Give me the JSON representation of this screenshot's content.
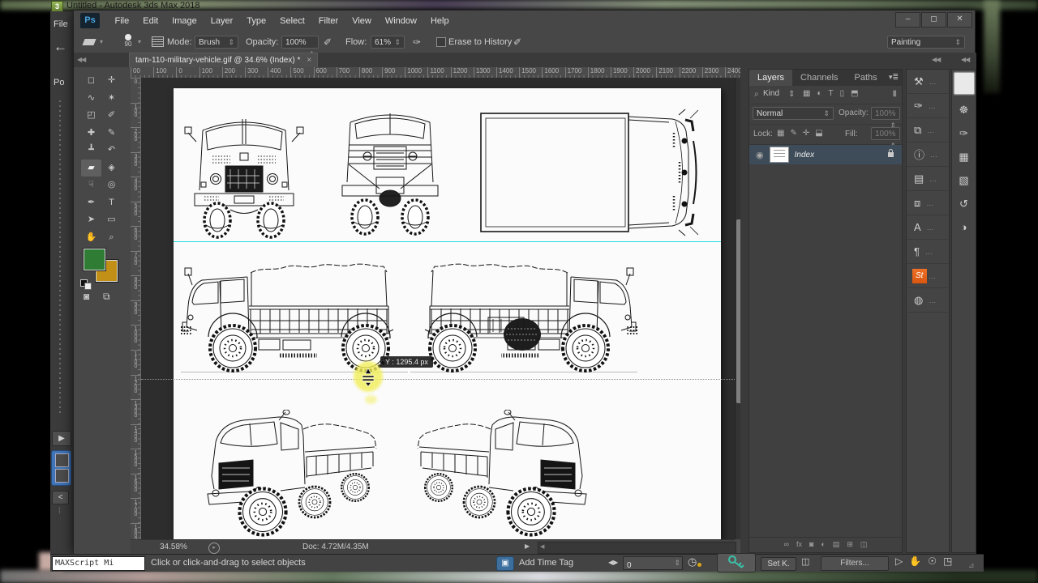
{
  "max_window": {
    "logo": "3",
    "title": "Untitled - Autodesk 3ds Max 2018",
    "file_menu": "File",
    "po_label": "Po",
    "play_glyph": "▶",
    "collapse_glyph": "<",
    "maxscript_label": "MAXScript Mi",
    "status_hint": "Click or click-and-drag to select objects",
    "add_time_tag": "Add Time Tag",
    "spinner_glyph": "◀▶",
    "frame_value": "0",
    "clock_glyph": "◷",
    "set_key_label": "Set K.",
    "key_filter_glyph": "◫",
    "filters_label": "Filters...",
    "nav_icons": [
      {
        "name": "zoom-mode-icon",
        "glyph": "▷"
      },
      {
        "name": "pan-hand-icon",
        "glyph": "✋"
      },
      {
        "name": "orbit-icon",
        "glyph": "☉"
      },
      {
        "name": "maximize-viewport-icon",
        "glyph": "◳"
      }
    ]
  },
  "photoshop": {
    "logo": "Ps",
    "menus": [
      "File",
      "Edit",
      "Image",
      "Layer",
      "Type",
      "Select",
      "Filter",
      "View",
      "Window",
      "Help"
    ],
    "window_buttons": [
      {
        "name": "minimize-button",
        "glyph": "–"
      },
      {
        "name": "maximize-button",
        "glyph": "◻"
      },
      {
        "name": "close-button",
        "glyph": "✕"
      }
    ],
    "collapse_glyph": "◀◀",
    "options_bar": {
      "tool_size": "90",
      "mode_label": "Mode:",
      "mode_value": "Brush",
      "opacity_label": "Opacity:",
      "opacity_value": "100%",
      "flow_label": "Flow:",
      "flow_value": "61%",
      "erase_history_label": "Erase to History",
      "workspace_value": "Painting"
    },
    "document_tab": {
      "title": "tam-110-military-vehicle.gif @ 34.6% (Index) *",
      "close_glyph": "×"
    },
    "ruler_h": [
      "00",
      "100",
      "0",
      "100",
      "200",
      "300",
      "400",
      "500",
      "600",
      "700",
      "800",
      "900",
      "1000",
      "1100",
      "1200",
      "1300",
      "1400",
      "1500",
      "1600",
      "1700",
      "1800",
      "1900",
      "2000",
      "2100",
      "2200",
      "2300",
      "2400"
    ],
    "ruler_v": [
      "0",
      "100",
      "200",
      "300",
      "400",
      "500",
      "600",
      "700",
      "800",
      "900",
      "1000",
      "1100",
      "1200",
      "1300",
      "1400",
      "1500",
      "1600",
      "1700",
      "1800"
    ],
    "tools": [
      {
        "name": "rectangular-marquee-tool",
        "glyph": "◻"
      },
      {
        "name": "move-tool",
        "glyph": "✛"
      },
      {
        "name": "lasso-tool",
        "glyph": "∿"
      },
      {
        "name": "magic-wand-tool",
        "glyph": "✶"
      },
      {
        "name": "crop-tool",
        "glyph": "◰"
      },
      {
        "name": "eyedropper-tool",
        "glyph": "✐"
      },
      {
        "name": "healing-brush-tool",
        "glyph": "✚"
      },
      {
        "name": "brush-tool",
        "glyph": "✎"
      },
      {
        "name": "clone-stamp-tool",
        "glyph": "┻"
      },
      {
        "name": "history-brush-tool",
        "glyph": "↶"
      },
      {
        "name": "eraser-tool",
        "glyph": "▰"
      },
      {
        "name": "paint-bucket-tool",
        "glyph": "◈"
      },
      {
        "name": "smudge-tool",
        "glyph": "☟"
      },
      {
        "name": "dodge-tool",
        "glyph": "◎"
      },
      {
        "name": "pen-tool",
        "glyph": "✒"
      },
      {
        "name": "type-tool",
        "glyph": "T"
      },
      {
        "name": "path-selection-tool",
        "glyph": "➤"
      },
      {
        "name": "rectangle-tool",
        "glyph": "▭"
      },
      {
        "name": "hand-tool",
        "glyph": "✋"
      },
      {
        "name": "zoom-tool",
        "glyph": "⌕"
      }
    ],
    "guide_tooltip": "Y :  1295.4 px",
    "status_bar": {
      "zoom_value": "34.58%",
      "doc_sizes": "Doc: 4.72M/4.35M",
      "popup_glyph": "▶",
      "scroll_glyph": "◀"
    },
    "layers_panel": {
      "tabs": [
        "Layers",
        "Channels",
        "Paths"
      ],
      "menu_glyph": "▾≣",
      "search_glyph": "⌕",
      "filter_label": "Kind",
      "filter_icons": [
        {
          "name": "filter-pixel-layers-icon",
          "glyph": "▦"
        },
        {
          "name": "filter-adjustment-layers-icon",
          "glyph": "◐"
        },
        {
          "name": "filter-type-layers-icon",
          "glyph": "T"
        },
        {
          "name": "filter-shape-layers-icon",
          "glyph": "▯"
        },
        {
          "name": "filter-smart-objects-icon",
          "glyph": "⬒"
        }
      ],
      "blend_mode": "Normal",
      "opacity_label": "Opacity:",
      "opacity_value": "100%",
      "lock_label": "Lock:",
      "lock_icons": [
        {
          "name": "lock-transparency-icon",
          "glyph": "▦"
        },
        {
          "name": "lock-pixels-icon",
          "glyph": "✎"
        },
        {
          "name": "lock-position-icon",
          "glyph": "✛"
        },
        {
          "name": "lock-all-icon",
          "glyph": "⬓"
        }
      ],
      "fill_label": "Fill:",
      "fill_value": "100%",
      "eye_glyph": "◉",
      "layer_name": "Index",
      "bottom_icons": [
        {
          "name": "link-layers-icon",
          "glyph": "∞"
        },
        {
          "name": "layer-effects-icon",
          "glyph": "fx"
        },
        {
          "name": "layer-mask-icon",
          "glyph": "◙"
        },
        {
          "name": "adjustment-layer-icon",
          "glyph": "◐"
        },
        {
          "name": "layer-group-icon",
          "glyph": "▤"
        },
        {
          "name": "new-layer-icon",
          "glyph": "⊞"
        },
        {
          "name": "delete-layer-icon",
          "glyph": "◫"
        }
      ]
    },
    "dock_column_a": [
      {
        "name": "tool-presets-icon",
        "glyph": "⚒"
      },
      {
        "name": "brush-presets-icon",
        "glyph": "✑"
      },
      {
        "name": "clone-source-icon",
        "glyph": "⧉"
      },
      {
        "name": "info-icon",
        "glyph": "ⓘ"
      },
      {
        "name": "properties-icon",
        "glyph": "▤"
      },
      {
        "name": "layer-comps-icon",
        "glyph": "⧈"
      },
      {
        "name": "character-icon",
        "glyph": "A"
      },
      {
        "name": "paragraph-icon",
        "glyph": "¶"
      },
      {
        "name": "stock-icon",
        "glyph": "St"
      },
      {
        "name": "color-themes-icon",
        "glyph": "◍"
      }
    ],
    "dock_column_b": [
      {
        "name": "preview-panel-icon",
        "glyph": ""
      },
      {
        "name": "navigator-icon",
        "glyph": "☸"
      },
      {
        "name": "brush-settings-icon",
        "glyph": "✑"
      },
      {
        "name": "swatches-icon",
        "glyph": "▦"
      },
      {
        "name": "color-icon",
        "glyph": "▧"
      },
      {
        "name": "history-icon",
        "glyph": "↺"
      },
      {
        "name": "adjustments-icon",
        "glyph": "◑"
      }
    ]
  }
}
